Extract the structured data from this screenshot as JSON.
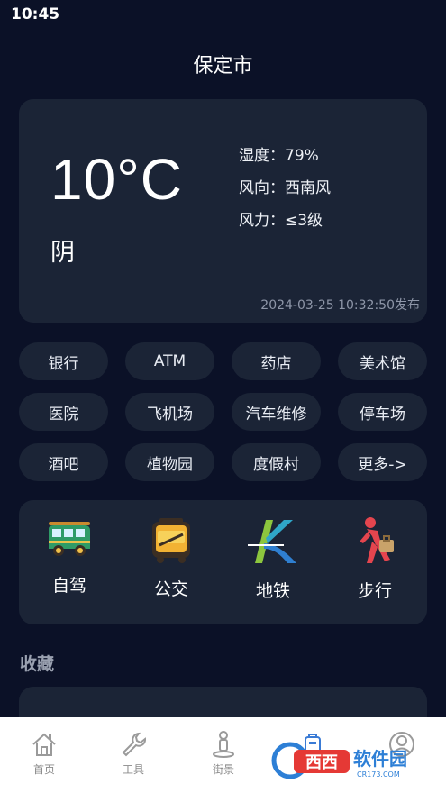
{
  "status_bar": {
    "time": "10:45"
  },
  "city": "保定市",
  "weather": {
    "temperature": "10°C",
    "condition": "阴",
    "humidity": "湿度：79%",
    "wind_direction": "风向：西南风",
    "wind_force": "风力：≤3级",
    "published": "2024-03-25 10:32:50发布"
  },
  "categories": [
    "银行",
    "ATM",
    "药店",
    "美术馆",
    "医院",
    "飞机场",
    "汽车维修",
    "停车场",
    "酒吧",
    "植物园",
    "度假村",
    "更多->"
  ],
  "transport": [
    {
      "label": "自驾",
      "icon": "car-icon"
    },
    {
      "label": "公交",
      "icon": "bus-icon"
    },
    {
      "label": "地铁",
      "icon": "subway-icon"
    },
    {
      "label": "步行",
      "icon": "walk-icon"
    }
  ],
  "favorites": {
    "title": "收藏"
  },
  "nav": [
    {
      "label": "首页",
      "icon": "home-icon"
    },
    {
      "label": "工具",
      "icon": "wrench-icon"
    },
    {
      "label": "街景",
      "icon": "street-view-icon"
    },
    {
      "label": "",
      "icon": "bag-icon"
    },
    {
      "label": "",
      "icon": "user-icon"
    }
  ],
  "watermark": {
    "brand": "西西",
    "text": "软件园",
    "domain": "CR173.COM"
  },
  "colors": {
    "background": "#0b1127",
    "card": "#1b2436",
    "nav_bg": "#ffffff"
  }
}
